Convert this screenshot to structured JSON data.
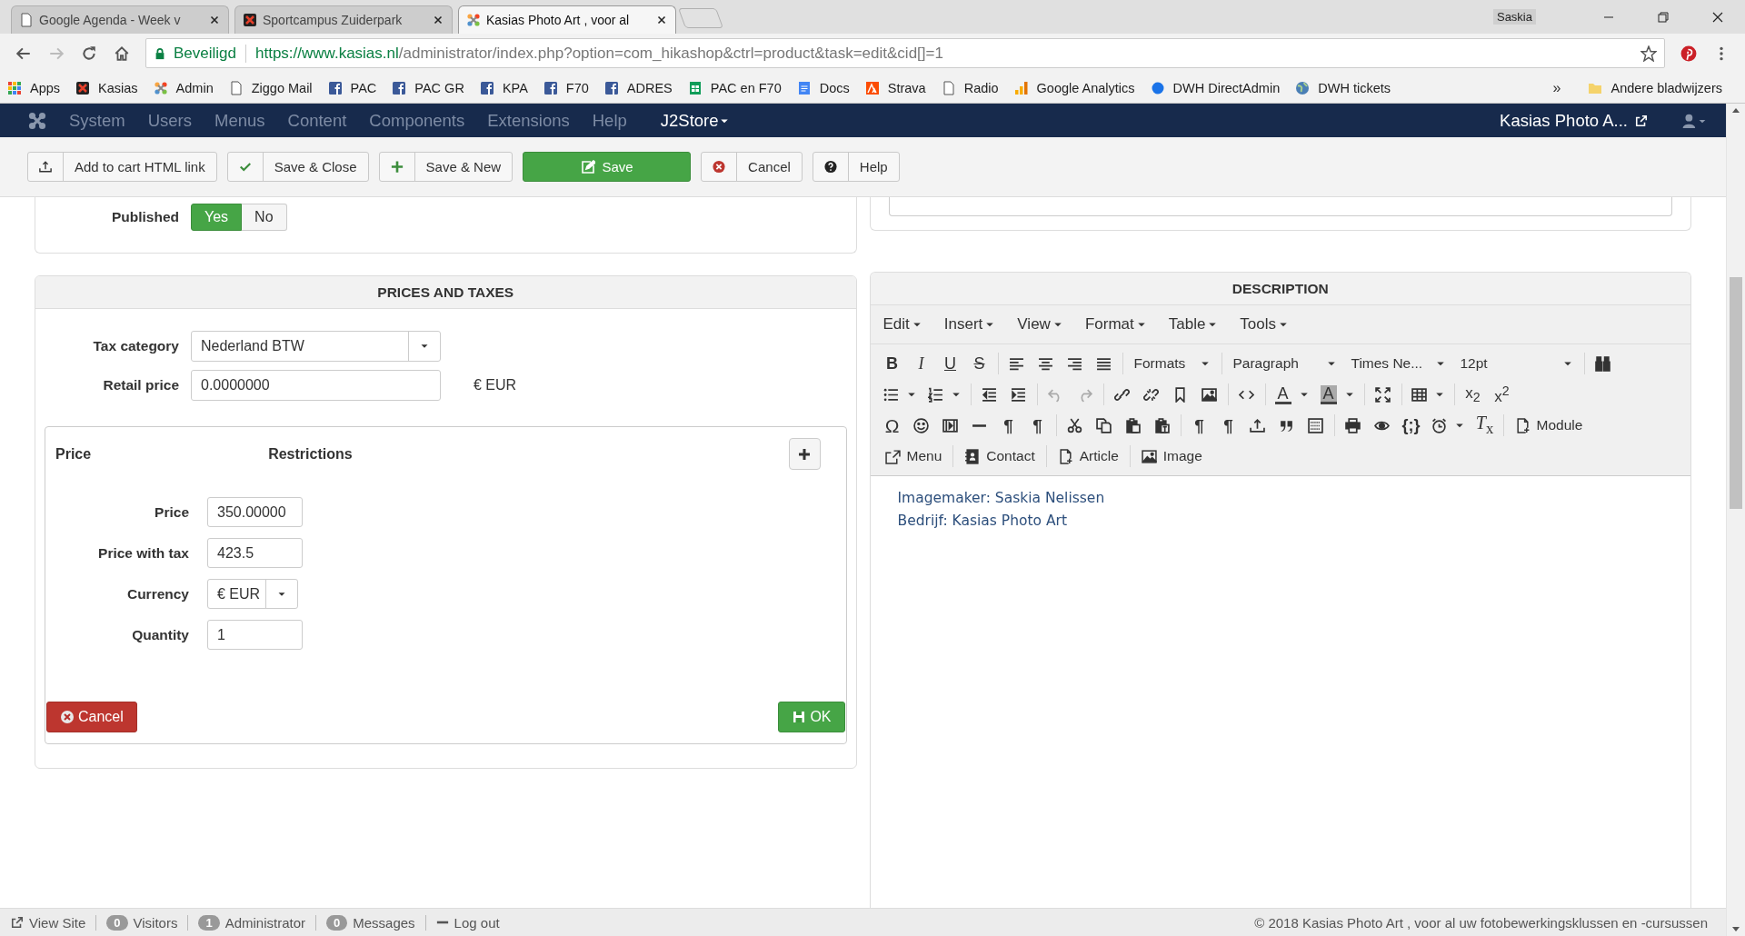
{
  "browser": {
    "tabs": [
      {
        "title": "Google Agenda - Week v",
        "kind": "page",
        "selected": false
      },
      {
        "title": "Sportcampus Zuiderpark",
        "kind": "site",
        "selected": false
      },
      {
        "title": "Kasias Photo Art , voor al",
        "kind": "cms",
        "selected": true
      }
    ],
    "profile": "Saskia",
    "address": {
      "secure_label": "Beveiligd",
      "host": "https://www.kasias.nl",
      "path": "/administrator/index.php?option=com_hikashop&ctrl=product&task=edit&cid[]=1"
    },
    "bookmarks": [
      {
        "label": "Apps",
        "kind": "apps"
      },
      {
        "label": "Kasias",
        "kind": "site"
      },
      {
        "label": "Admin",
        "kind": "cms"
      },
      {
        "label": "Ziggo Mail",
        "kind": "page"
      },
      {
        "label": "PAC",
        "kind": "social"
      },
      {
        "label": "PAC GR",
        "kind": "social"
      },
      {
        "label": "KPA",
        "kind": "social"
      },
      {
        "label": "F70",
        "kind": "social"
      },
      {
        "label": "ADRES",
        "kind": "social"
      },
      {
        "label": "PAC en F70",
        "kind": "sheet"
      },
      {
        "label": "Docs",
        "kind": "doc"
      },
      {
        "label": "Strava",
        "kind": "sport"
      },
      {
        "label": "Radio",
        "kind": "page"
      },
      {
        "label": "Google Analytics",
        "kind": "chart"
      },
      {
        "label": "DWH DirectAdmin",
        "kind": "dot"
      },
      {
        "label": "DWH tickets",
        "kind": "globe"
      }
    ],
    "bookmarks_more": "»",
    "other_bookmarks": "Andere bladwijzers"
  },
  "admin_menu": {
    "items": [
      "System",
      "Users",
      "Menus",
      "Content",
      "Components",
      "Extensions",
      "Help"
    ],
    "store": "J2Store",
    "site_title": "Kasias Photo A..."
  },
  "toolbar": [
    {
      "label": "Add to cart HTML link",
      "kind": "link"
    },
    {
      "label": "Save & Close",
      "kind": "save-close"
    },
    {
      "label": "Save & New",
      "kind": "save-new"
    },
    {
      "label": "Save",
      "kind": "save"
    },
    {
      "label": "Cancel",
      "kind": "cancel"
    },
    {
      "label": "Help",
      "kind": "help"
    }
  ],
  "published": {
    "label": "Published",
    "options": [
      {
        "label": "Yes",
        "selected": true
      },
      {
        "label": "No",
        "selected": false
      }
    ]
  },
  "prices": {
    "title": "PRICES AND TAXES",
    "tax_category": {
      "label": "Tax category",
      "value": "Nederland BTW"
    },
    "retail_price": {
      "label": "Retail price",
      "value": "0.0000000",
      "currency": "€ EUR"
    },
    "editor": {
      "columns": [
        "Price",
        "Restrictions"
      ],
      "fields": [
        {
          "label": "Price",
          "value": "350.00000",
          "kind": "input"
        },
        {
          "label": "Price with tax",
          "value": "423.5",
          "kind": "input"
        },
        {
          "label": "Currency",
          "value": "€ EUR",
          "kind": "select"
        },
        {
          "label": "Quantity",
          "value": "1",
          "kind": "input"
        }
      ],
      "cancel": "Cancel",
      "ok": "OK"
    }
  },
  "description": {
    "title": "DESCRIPTION",
    "menus": [
      "Edit",
      "Insert",
      "View",
      "Format",
      "Table",
      "Tools"
    ],
    "dropdowns": [
      "Formats",
      "Paragraph",
      "Times Ne...",
      "12pt"
    ],
    "glyphs": [
      "B",
      "I",
      "U",
      "S",
      "A",
      "A",
      "x$_{2}$",
      "x$^{2}$",
      "Ω",
      "¶",
      "¶",
      "¶",
      "¶",
      "{;}",
      "*T*$_{x}$"
    ],
    "undo": {
      "disabled": true
    },
    "redo": {
      "disabled": true
    },
    "insert_buttons": [
      "Module",
      "Menu",
      "Contact",
      "Article",
      "Image"
    ],
    "content": [
      "Imagemaker: Saskia Nelissen",
      "Bedrijf: Kasias Photo Art"
    ]
  },
  "status_bar": {
    "items": [
      {
        "kind": "link",
        "label": "View Site"
      },
      {
        "kind": "count",
        "count": "0",
        "label": "Visitors"
      },
      {
        "kind": "count",
        "count": "1",
        "label": "Administrator"
      },
      {
        "kind": "count",
        "count": "0",
        "label": "Messages"
      },
      {
        "kind": "logout",
        "label": "Log out"
      }
    ],
    "copyright": "© 2018 Kasias Photo Art , voor al uw fotobewerkingsklussen en -cursussen"
  }
}
